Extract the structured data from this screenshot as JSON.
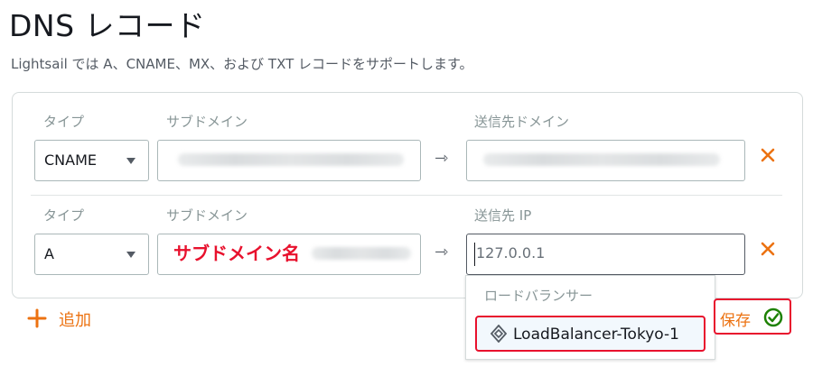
{
  "header": {
    "title": "DNS レコード",
    "description": "Lightsail では A、CNAME、MX、および TXT レコードをサポートします。"
  },
  "records": [
    {
      "type_label": "タイプ",
      "subdomain_label": "サブドメイン",
      "target_label": "送信先ドメイン",
      "type_value": "CNAME"
    },
    {
      "type_label": "タイプ",
      "subdomain_label": "サブドメイン",
      "target_label": "送信先 IP",
      "type_value": "A",
      "subdomain_annotation": "サブドメイン名",
      "target_value": "127.0.0.1"
    }
  ],
  "dropdown": {
    "group_label": "ロードバランサー",
    "option_label": "LoadBalancer-Tokyo-1"
  },
  "actions": {
    "add_label": "追加",
    "save_label": "保存"
  },
  "colors": {
    "accent": "#ec7211",
    "annotation": "#e8112d",
    "success": "#1d8102"
  },
  "icons": {
    "arrow": "arrow-right-icon",
    "remove": "close-icon",
    "add": "plus-icon",
    "dropdown": "caret-down-icon",
    "load_balancer": "load-balancer-icon",
    "save": "check-circle-icon"
  }
}
